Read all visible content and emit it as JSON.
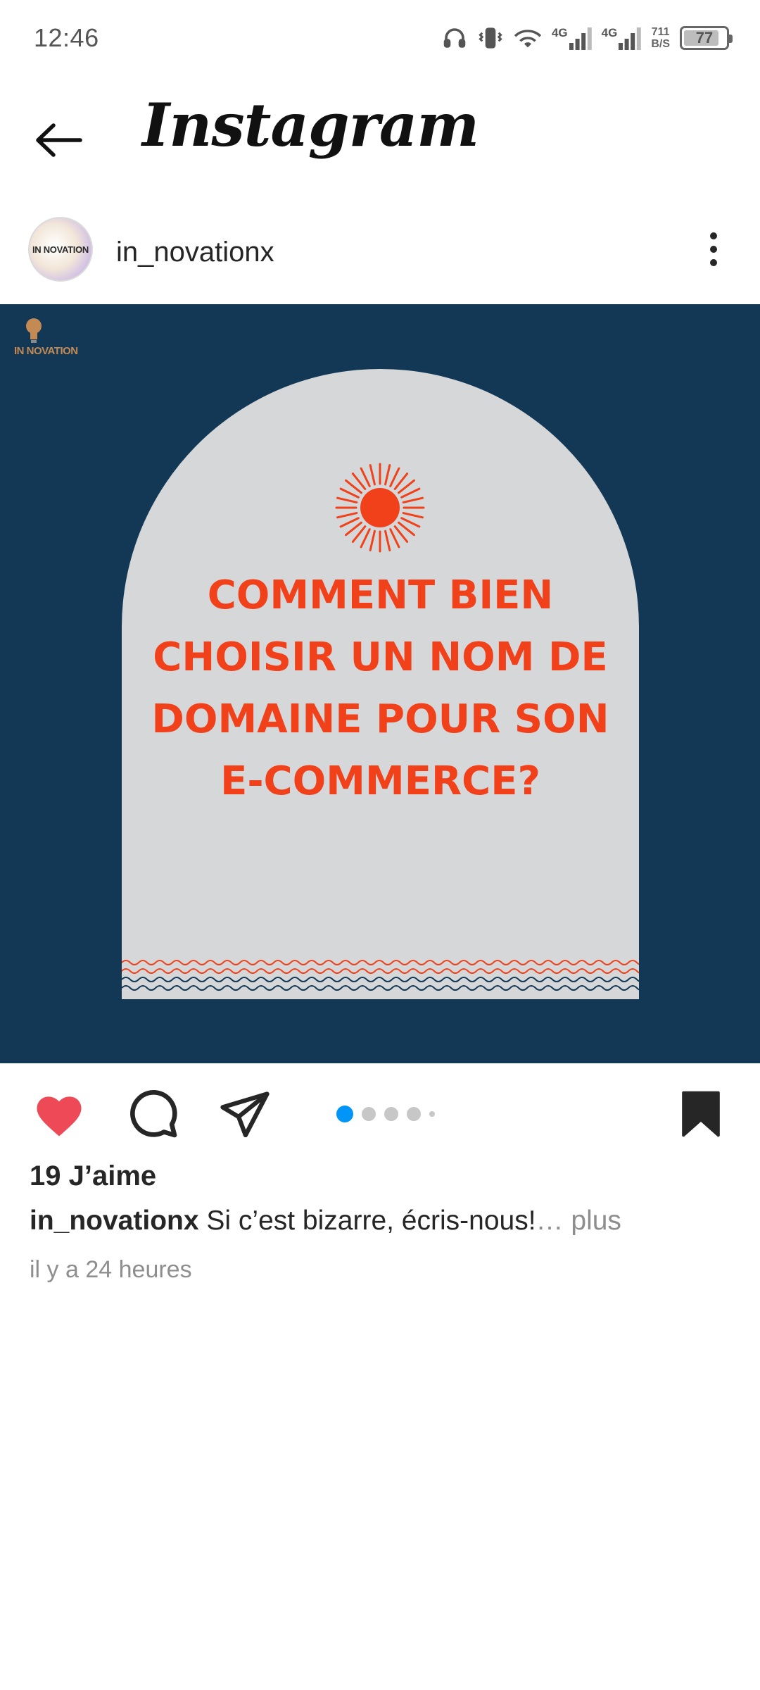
{
  "status_bar": {
    "time": "12:46",
    "network_1": "4G",
    "network_2": "4G",
    "speed_value": "711",
    "speed_unit": "B/S",
    "battery": "77",
    "icons": [
      "headphones-icon",
      "vibrate-icon",
      "wifi-icon",
      "signal-icon",
      "signal-icon",
      "battery-icon"
    ]
  },
  "header": {
    "back_icon": "arrow-left-icon",
    "app_name": "Instagram"
  },
  "post": {
    "username": "in_novationx",
    "avatar_text": "IN NOVATION",
    "more_icon": "more-vertical-icon",
    "image": {
      "brand_text": "IN NOVATION",
      "headline_lines": [
        "COMMENT BIEN",
        "CHOISIR UN NOM DE",
        "DOMAINE POUR SON",
        "E-COMMERCE?"
      ],
      "background_color": "#133855",
      "arch_color": "#d5d7d9",
      "accent_color": "#f0411b"
    },
    "actions": {
      "like_icon": "heart-filled-icon",
      "comment_icon": "comment-icon",
      "share_icon": "paper-plane-icon",
      "save_icon": "bookmark-filled-icon",
      "carousel_dots": 5,
      "carousel_active_index": 0
    },
    "likes": "19 J’aime",
    "caption": {
      "username": "in_novationx",
      "text": "Si c’est bizarre, écris-nous!",
      "more": "… plus"
    },
    "timestamp": "il y a 24 heures"
  },
  "colors": {
    "like_red": "#ed4956",
    "active_dot": "#0095f6"
  }
}
